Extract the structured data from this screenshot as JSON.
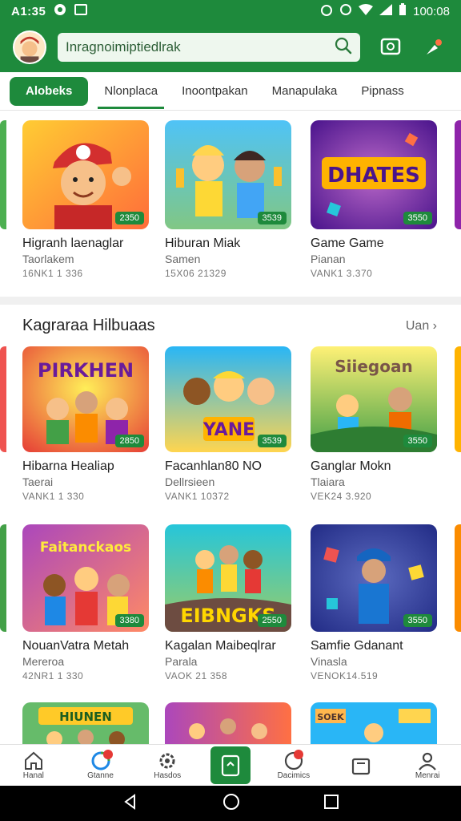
{
  "status_bar": {
    "time": "A1:35",
    "clock": "100:08"
  },
  "search": {
    "value": "Inragnoimiptiedlrak"
  },
  "tabs": [
    {
      "label": "Alobeks"
    },
    {
      "label": "Nlonplaca"
    },
    {
      "label": "Inoontpakan"
    },
    {
      "label": "Manapulaka"
    },
    {
      "label": "Pipnass"
    }
  ],
  "row1": [
    {
      "title": "Higranh laenaglar",
      "subtitle": "Taorlakem",
      "meta": "16NK1 1 336",
      "badge": "2350",
      "art": "Boy in red cap",
      "colors": [
        "#ffb347",
        "#ff7043"
      ]
    },
    {
      "title": "Hiburan Miak",
      "subtitle": "Samen",
      "meta": "15X06 21329",
      "badge": "3539",
      "art": "Kids with trophies",
      "colors": [
        "#4fc3f7",
        "#81c784"
      ]
    },
    {
      "title": "Game Game",
      "subtitle": "Pianan",
      "meta": "VANK1 3.370",
      "badge": "3550",
      "art": "DHATES",
      "colors": [
        "#7e57c2",
        "#ba68c8"
      ]
    }
  ],
  "section": {
    "title": "Kagraraa Hilbuaas",
    "link": "Uan"
  },
  "row2": [
    {
      "title": "Hibarna Healiap",
      "subtitle": "Taerai",
      "meta": "VANK1 1 330",
      "badge": "2850",
      "art": "PIRKHEN",
      "colors": [
        "#ffca28",
        "#ef5350"
      ]
    },
    {
      "title": "Facanhlan80 NO",
      "subtitle": "Dellrsieen",
      "meta": "VANK1 10372",
      "badge": "3539",
      "art": "YANE",
      "colors": [
        "#29b6f6",
        "#ffd54f"
      ]
    },
    {
      "title": "Ganglar Mokn",
      "subtitle": "Tlaiara",
      "meta": "VEK24 3.920",
      "badge": "3550",
      "art": "Siiegoan",
      "colors": [
        "#66bb6a",
        "#ffee58"
      ]
    }
  ],
  "row3": [
    {
      "title": "NouanVatra Metah",
      "subtitle": "Mereroa",
      "meta": "42NR1 1 330",
      "badge": "3380",
      "art": "Faitanckaos",
      "colors": [
        "#ab47bc",
        "#ff8a65"
      ]
    },
    {
      "title": "Kagalan Maibeqlrar",
      "subtitle": "Parala",
      "meta": "VAOK 21 358",
      "badge": "2550",
      "art": "EIBNGKS",
      "colors": [
        "#26c6da",
        "#9ccc65"
      ]
    },
    {
      "title": "Samfie Gdanant",
      "subtitle": "Vinasla",
      "meta": "VENOK14.519",
      "badge": "3550",
      "art": "Miner",
      "colors": [
        "#283593",
        "#5c6bc0"
      ]
    }
  ],
  "row4": [
    {
      "art": "HIUNEN",
      "colors": [
        "#66bb6a",
        "#ffca28"
      ]
    },
    {
      "art": "Kids Pains",
      "colors": [
        "#ab47bc",
        "#ff7043"
      ]
    },
    {
      "art": "SOEK",
      "colors": [
        "#29b6f6",
        "#ffb74d"
      ]
    }
  ],
  "bottom_nav": [
    {
      "label": "Hanal"
    },
    {
      "label": "Gtanne"
    },
    {
      "label": "Hasdos"
    },
    {
      "label": ""
    },
    {
      "label": "Dacimics"
    },
    {
      "label": ""
    },
    {
      "label": "Menrai"
    }
  ],
  "colors": {
    "brand": "#1e8a3c",
    "badge": "#1e8a3c",
    "alert": "#e53935"
  }
}
